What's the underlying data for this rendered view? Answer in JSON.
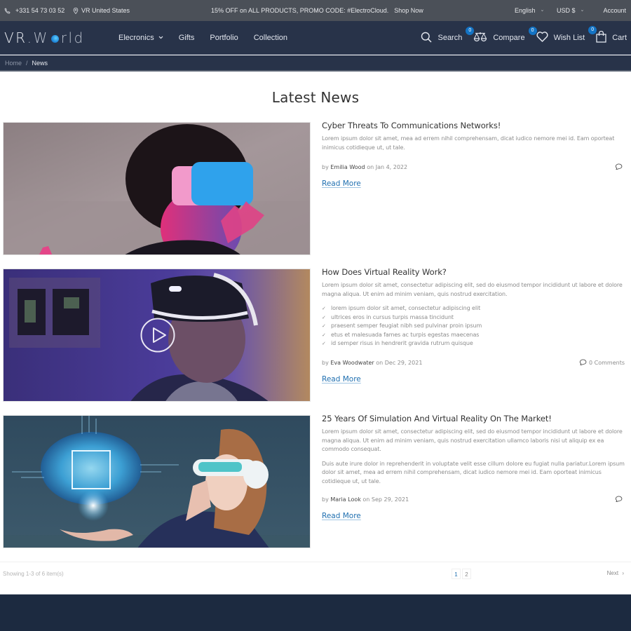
{
  "topbar": {
    "phone": "+331 54 73 03 52",
    "location": "VR United States",
    "promo": "15% OFF on ALL PRODUCTS, PROMO CODE: #ElectroCloud.",
    "promo_link": "Shop Now",
    "language": "English",
    "currency": "USD $",
    "account": "Account"
  },
  "header": {
    "logo": {
      "part1": "VR",
      "dot": ".",
      "part2": "W",
      "part3": "rld"
    },
    "nav": [
      {
        "label": "Elecronics",
        "has_dropdown": true
      },
      {
        "label": "Gifts"
      },
      {
        "label": "Portfolio"
      },
      {
        "label": "Collection"
      }
    ],
    "actions": {
      "search": "Search",
      "compare": "Compare",
      "compare_count": "0",
      "wishlist": "Wish List",
      "wishlist_count": "0",
      "cart": "Cart",
      "cart_count": "0"
    },
    "badge_color": "#1373c4"
  },
  "breadcrumb": {
    "home": "Home",
    "separator": "/",
    "current": "News"
  },
  "page": {
    "title": "Latest News"
  },
  "posts": [
    {
      "title": "Cyber Threats To Communications Networks!",
      "excerpt": [
        "Lorem ipsum dolor sit amet, mea ad errem nihil comprehensam, dicat iudico nemore mei id. Eam oporteat inimicus cotidieque ut, ut tale."
      ],
      "bullets": [],
      "by": "by",
      "author": "Emilia Wood",
      "on": "on",
      "date": "Jan 4, 2022",
      "comments": "",
      "read_more": "Read More",
      "image": "woman-pink-vr-headset-photo",
      "has_video": false
    },
    {
      "title": "How Does Virtual Reality Work?",
      "excerpt": [
        "Lorem ipsum dolor sit amet, consectetur adipiscing elit, sed do eiusmod tempor incididunt ut labore et dolore magna aliqua. Ut enim ad minim veniam, quis nostrud exercitation."
      ],
      "bullets": [
        "lorem ipsum dolor sit amet, consectetur adipiscing elit",
        "ultrices eros in cursus turpis massa tincidunt",
        "praesent semper feugiat nibh sed pulvinar proin ipsum",
        "etus et malesuada fames ac turpis egestas maecenas",
        "id semper risus in hendrerit gravida rutrum quisque"
      ],
      "by": "by",
      "author": "Eva Woodwater",
      "on": "on",
      "date": "Dec 29, 2021",
      "comments": "0 Comments",
      "read_more": "Read More",
      "image": "man-vr-headset-purple-photo",
      "has_video": true
    },
    {
      "title": "25 Years Of Simulation And Virtual Reality On The Market!",
      "excerpt": [
        "Lorem ipsum dolor sit amet, consectetur adipiscing elit, sed do eiusmod tempor incididunt ut labore et dolore magna aliqua. Ut enim ad minim veniam, quis nostrud exercitation ullamco laboris nisi ut aliquip ex ea commodo consequat.",
        "Duis aute irure dolor in reprehenderit in voluptate velit esse cillum dolore eu fugiat nulla pariatur.Lorem ipsum dolor sit amet, mea ad errem nihil comprehensam, dicat iudico nemore mei id. Eam oporteat inimicus cotidieque ut, ut tale."
      ],
      "bullets": [],
      "by": "by",
      "author": "Maria Look",
      "on": "on",
      "date": "Sep 29, 2021",
      "comments": "",
      "read_more": "Read More",
      "image": "woman-vr-glasses-digital-brain-photo",
      "has_video": false
    }
  ],
  "pagination": {
    "showing": "Showing 1-3 of 6 item(s)",
    "pages": [
      "1",
      "2"
    ],
    "current_page": "1",
    "next": "Next"
  },
  "colors": {
    "topbar": "#4b5058",
    "header": "#283349",
    "link": "#1f6fb0",
    "footer": "#1c2a40"
  }
}
